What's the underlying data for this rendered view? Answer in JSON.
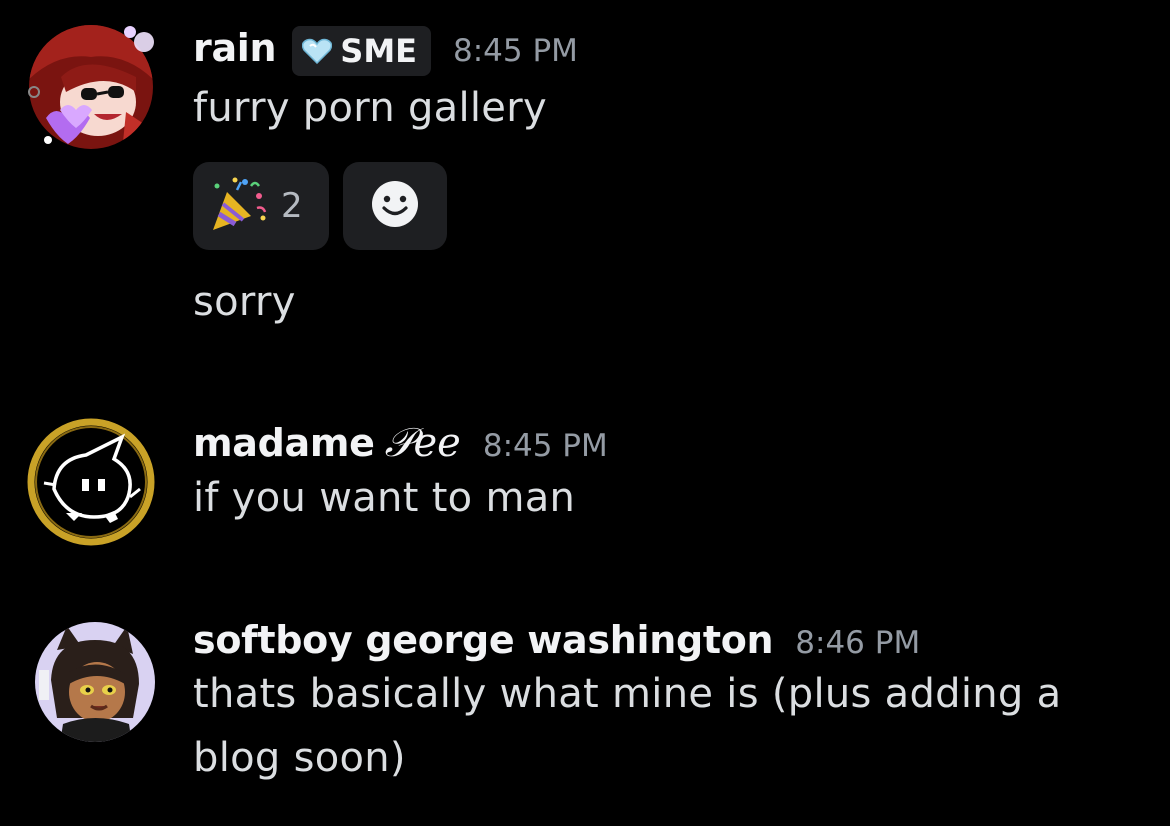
{
  "messages": [
    {
      "username": "rain",
      "tag": "SME",
      "timestamp": "8:45 PM",
      "lines": [
        "furry porn gallery",
        "sorry"
      ],
      "reactions": [
        {
          "emoji": "party-popper-icon",
          "count": "2"
        },
        {
          "emoji": "add-reaction-icon",
          "count": ""
        }
      ]
    },
    {
      "username": "madame",
      "username_deco": "𝒫ee",
      "timestamp": "8:45 PM",
      "lines": [
        "if you want to man"
      ]
    },
    {
      "username": "softboy george washington",
      "timestamp": "8:46 PM",
      "lines": [
        "thats basically what mine is (plus adding a",
        "blog soon)"
      ]
    }
  ],
  "colors": {
    "background": "#000000",
    "username": "#f2f3f5",
    "text": "#dbdee1",
    "timestamp": "#949ba4",
    "chip": "#1e1f22",
    "gold_ring": "#c9a227"
  }
}
